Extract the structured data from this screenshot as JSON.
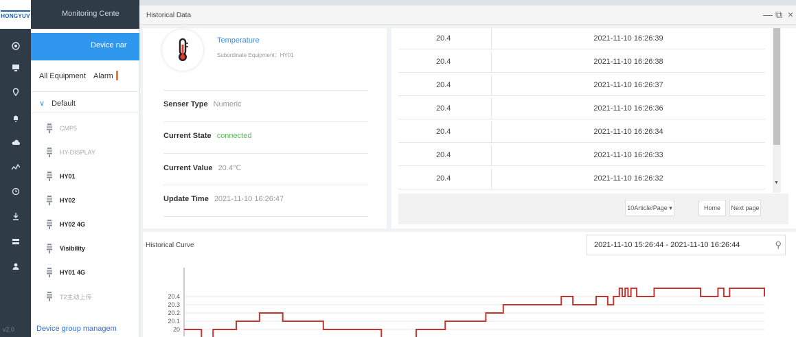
{
  "app": {
    "logo_text": "HONGYUV",
    "monitoring_center": "Monitoring Cente",
    "version": "v2.0"
  },
  "rail_icons": [
    "target-icon",
    "monitor-icon",
    "location-icon",
    "bell-icon",
    "cloud-icon",
    "pulse-icon",
    "clock-icon",
    "download-icon",
    "storage-icon",
    "user-icon"
  ],
  "device_panel": {
    "search_label": "Device nar",
    "tabs": [
      "All Equipment",
      "Alarm"
    ],
    "group": "Default",
    "devices": [
      {
        "name": "CMP5",
        "online": false
      },
      {
        "name": "HY-DISPLAY",
        "online": false
      },
      {
        "name": "HY01",
        "online": true
      },
      {
        "name": "HY02",
        "online": true
      },
      {
        "name": "HY02 4G",
        "online": true
      },
      {
        "name": "Visibility",
        "online": true
      },
      {
        "name": "HY01 4G",
        "online": true
      },
      {
        "name": "T2主动上传",
        "online": false
      }
    ],
    "group_manage": "Device group managem"
  },
  "window": {
    "title": "Historical Data",
    "controls": [
      "—",
      "⧉",
      "×"
    ]
  },
  "sensor": {
    "name": "Temperature",
    "subordinate": "Subordinate Equipment：HY01",
    "fields": [
      {
        "key": "Senser Type",
        "value": "Numeric",
        "status": "normal"
      },
      {
        "key": "Current State",
        "value": "connected",
        "status": "ok"
      },
      {
        "key": "Current Value",
        "value": "20.4℃",
        "status": "normal"
      },
      {
        "key": "Update Time",
        "value": "2021-11-10 16:26:47",
        "status": "normal"
      }
    ]
  },
  "history_table": {
    "rows": [
      {
        "value": "20.4",
        "time": "2021-11-10 16:26:39"
      },
      {
        "value": "20.4",
        "time": "2021-11-10 16:26:38"
      },
      {
        "value": "20.4",
        "time": "2021-11-10 16:26:37"
      },
      {
        "value": "20.4",
        "time": "2021-11-10 16:26:36"
      },
      {
        "value": "20.4",
        "time": "2021-11-10 16:26:34"
      },
      {
        "value": "20.4",
        "time": "2021-11-10 16:26:33"
      },
      {
        "value": "20.4",
        "time": "2021-11-10 16:26:32"
      }
    ],
    "page_size": "10Article/Page",
    "home": "Home",
    "next": "Next page"
  },
  "curve": {
    "title": "Historical Curve",
    "range": "2021-11-10 15:26:44 - 2021-11-10 16:26:44",
    "line_color": "#c23531"
  },
  "chart_data": {
    "type": "line",
    "step": true,
    "yticks": [
      "20",
      "20.1",
      "20.2",
      "20.3",
      "20.4"
    ],
    "ylim": [
      20,
      20.5
    ],
    "x": [
      0,
      3,
      5,
      9,
      13,
      17,
      24,
      34,
      40,
      45,
      52,
      55,
      57,
      65,
      67,
      71,
      73,
      74,
      75,
      75.5,
      76,
      76.5,
      77,
      78,
      81,
      83,
      88,
      89,
      92,
      93,
      94,
      100
    ],
    "values": [
      20,
      19.9,
      20,
      20.1,
      20.2,
      20.1,
      20,
      19.9,
      20,
      20.1,
      20.2,
      20.3,
      20.3,
      20.4,
      20.3,
      20.4,
      20.3,
      20.4,
      20.5,
      20.4,
      20.5,
      20.4,
      20.5,
      20.4,
      20.5,
      20.5,
      20.5,
      20.4,
      20.5,
      20.4,
      20.5,
      20.4
    ],
    "xlim": [
      0,
      100
    ]
  }
}
